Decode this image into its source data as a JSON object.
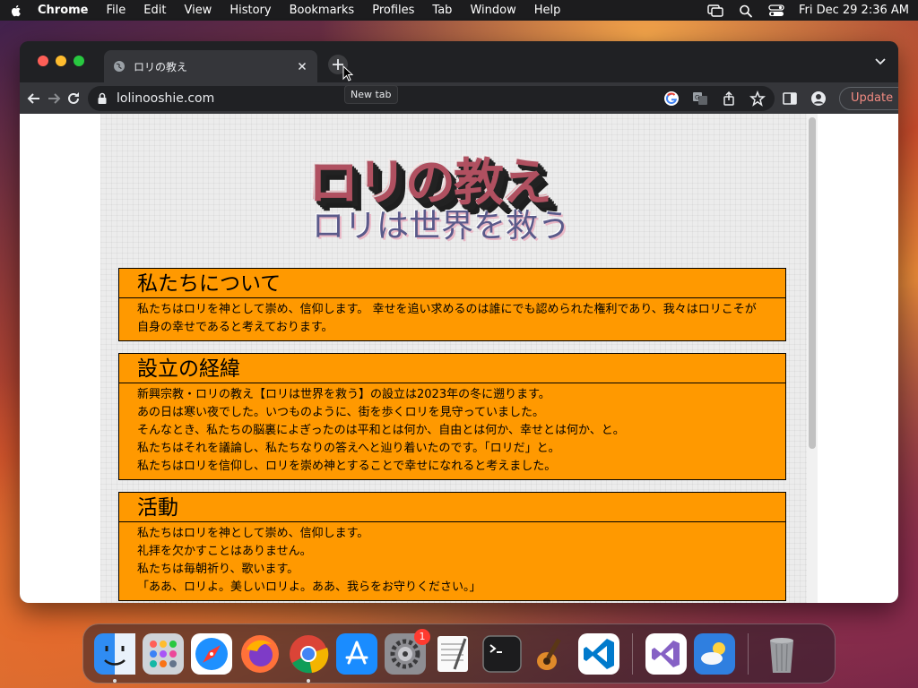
{
  "menubar": {
    "app_name": "Chrome",
    "items": [
      "File",
      "Edit",
      "View",
      "History",
      "Bookmarks",
      "Profiles",
      "Tab",
      "Window",
      "Help"
    ],
    "clock": "Fri Dec 29  2:36 AM"
  },
  "browser": {
    "tab_title": "ロリの教え",
    "new_tab_tooltip": "New tab",
    "url": "lolinooshie.com",
    "update_label": "Update"
  },
  "page": {
    "hero_title": "ロリの教え",
    "hero_subtitle": "ロリは世界を救う",
    "sections": [
      {
        "heading": "私たちについて",
        "lines": [
          "私たちはロリを神として崇め、信仰します。 幸せを追い求めるのは誰にでも認められた権利であり、我々はロリこそが自身の幸せであると考えております。"
        ]
      },
      {
        "heading": "設立の経緯",
        "lines": [
          "新興宗教・ロリの教え【ロリは世界を救う】の設立は2023年の冬に遡ります。",
          "あの日は寒い夜でした。いつものように、街を歩くロリを見守っていました。",
          "そんなとき、私たちの脳裏によぎったのは平和とは何か、自由とは何か、幸せとは何か、と。",
          "私たちはそれを議論し、私たちなりの答えへと辿り着いたのです。「ロリだ」と。",
          "私たちはロリを信仰し、ロリを崇め神とすることで幸せになれると考えました。"
        ]
      },
      {
        "heading": "活動",
        "lines": [
          "私たちはロリを神として崇め、信仰します。",
          "礼拝を欠かすことはありません。",
          "私たちは毎朝祈り、歌います。",
          "「ああ、ロリよ。美しいロリよ。ああ、我らをお守りください。」"
        ]
      }
    ]
  },
  "dock": {
    "apps": [
      "finder-icon",
      "launchpad-icon",
      "safari-icon",
      "firefox-icon",
      "chrome-icon",
      "app-store-icon",
      "system-settings-icon",
      "textedit-icon",
      "terminal-icon",
      "garageband-icon",
      "vscode-icon",
      "visual-studio-icon",
      "weather-icon",
      "trash-icon"
    ],
    "settings_badge": "1"
  }
}
